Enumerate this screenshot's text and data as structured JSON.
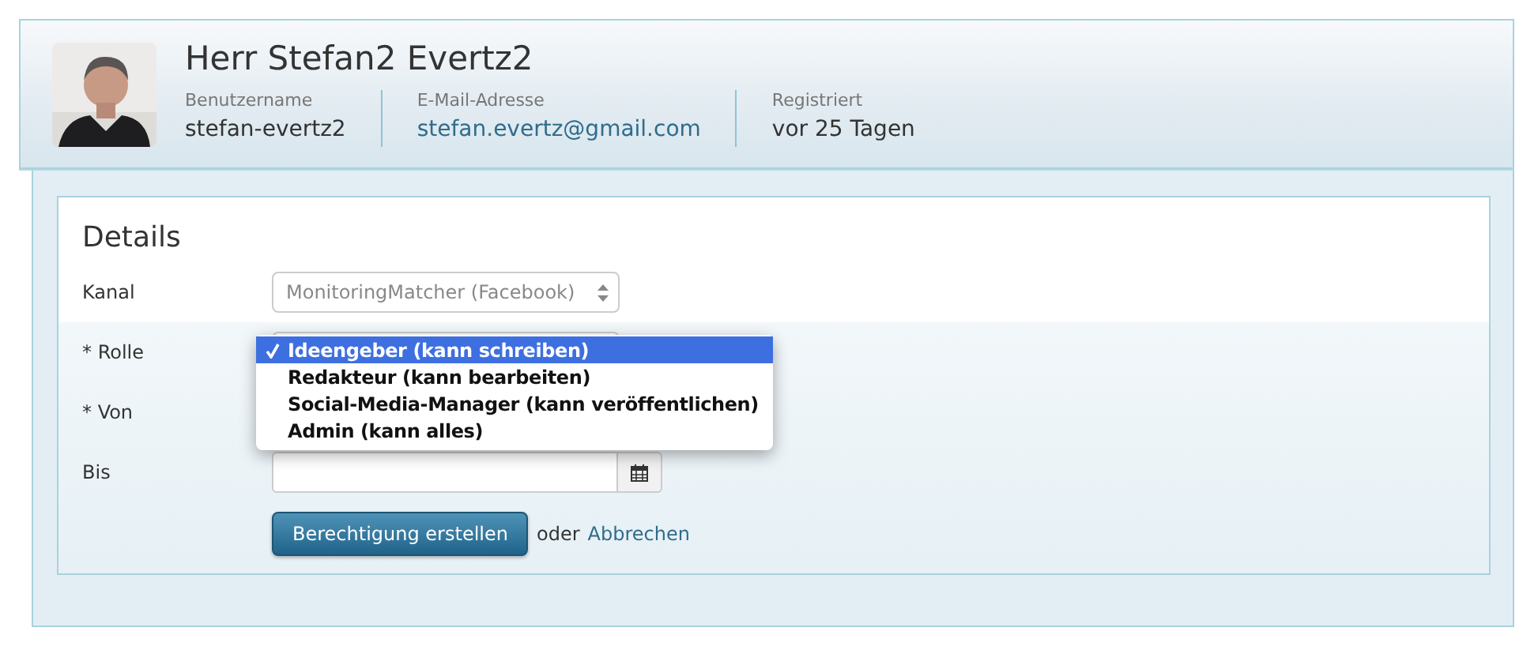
{
  "profile": {
    "name": "Herr Stefan2 Evertz2",
    "fields": [
      {
        "label": "Benutzername",
        "value": "stefan-evertz2",
        "kind": "text"
      },
      {
        "label": "E-Mail-Adresse",
        "value": "stefan.evertz@gmail.com",
        "kind": "link"
      },
      {
        "label": "Registriert",
        "value": "vor 25 Tagen",
        "kind": "text"
      }
    ]
  },
  "details": {
    "title": "Details",
    "fields": [
      {
        "label": "Kanal",
        "kind": "select",
        "value": "MonitoringMatcher (Facebook)",
        "disabled": true
      },
      {
        "label": "* Rolle",
        "kind": "select",
        "disabled": false,
        "menu": {
          "options": [
            {
              "label": "Ideengeber (kann schreiben)",
              "selected": true
            },
            {
              "label": "Redakteur (kann bearbeiten)",
              "selected": false
            },
            {
              "label": "Social-Media-Manager (kann veröffentlichen)",
              "selected": false
            },
            {
              "label": "Admin (kann alles)",
              "selected": false
            }
          ]
        }
      },
      {
        "label": "* Von"
      },
      {
        "label": "Bis",
        "kind": "date"
      }
    ],
    "submit": "Berechtigung erstellen",
    "separator": "oder",
    "cancel": "Abbrechen"
  }
}
